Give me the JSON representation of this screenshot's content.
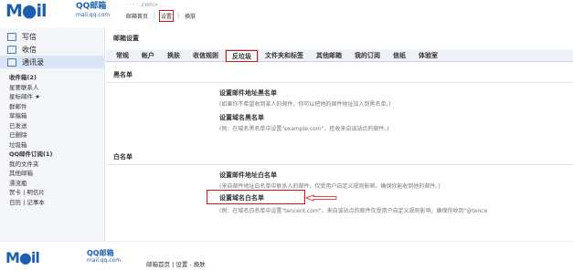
{
  "header": {
    "logo": "M●il",
    "logo_cn": "QQ邮箱",
    "logo_url": "mail.qq.com",
    "user": "·  ·  ·   ·  .com>",
    "nav": [
      "邮箱首页",
      "设置",
      "换肤"
    ],
    "nav_sep": "|"
  },
  "sidebar": {
    "buttons": [
      "写信",
      "收信",
      "通讯录"
    ],
    "items": [
      "收件箱(2)",
      "星要联系人 ",
      "星标邮件 ★",
      "群邮件",
      "草稿箱",
      "已发送",
      "已删除",
      "垃圾箱",
      "QQ邮件订阅(1)",
      "我的文件夹",
      "其他邮箱",
      "漂流瓶",
      "贺卡 | 明信片",
      "日历 | 记事本"
    ]
  },
  "main": {
    "title": "邮箱设置",
    "tabs": [
      "常规",
      "帐户",
      "换肤",
      "收信规则",
      "反垃圾",
      "文件夹和标签",
      "其他邮箱",
      "我的订阅",
      "信纸",
      "体验室"
    ],
    "blacklist": {
      "heading": "黑名单",
      "items": [
        {
          "title": "设置邮件地址黑名单",
          "desc": "(如果你不希望收到某人的邮件，你可以把他的邮件地址加入到黑名单。)"
        },
        {
          "title": "设置域名黑名单",
          "desc": "(例：在域名黑名单中设置\"example.com\"，拒收来自该站点的邮件。)"
        }
      ]
    },
    "whitelist": {
      "heading": "白名单",
      "items": [
        {
          "title": "设置邮件地址白名单",
          "desc": "(来自邮件地址白名单中联系人的邮件，仅受用户自定义规则影响，确保你能收到他的邮件。)"
        },
        {
          "title": "设置域名白名单",
          "desc": "(例：在域名白名单中设置\"tencent.com\"，来自该站点的邮件仅受用户自定义规则影响，确保你收到\"@tence"
        }
      ]
    }
  },
  "footer": {
    "logo": "M●il",
    "logo_cn": "QQ邮箱",
    "logo_url": "mail.qq.com",
    "nav": "邮箱首页 | 设置 - 换肤"
  },
  "colors": {
    "brand": "#1d5fae",
    "highlight": "#dd1111"
  }
}
